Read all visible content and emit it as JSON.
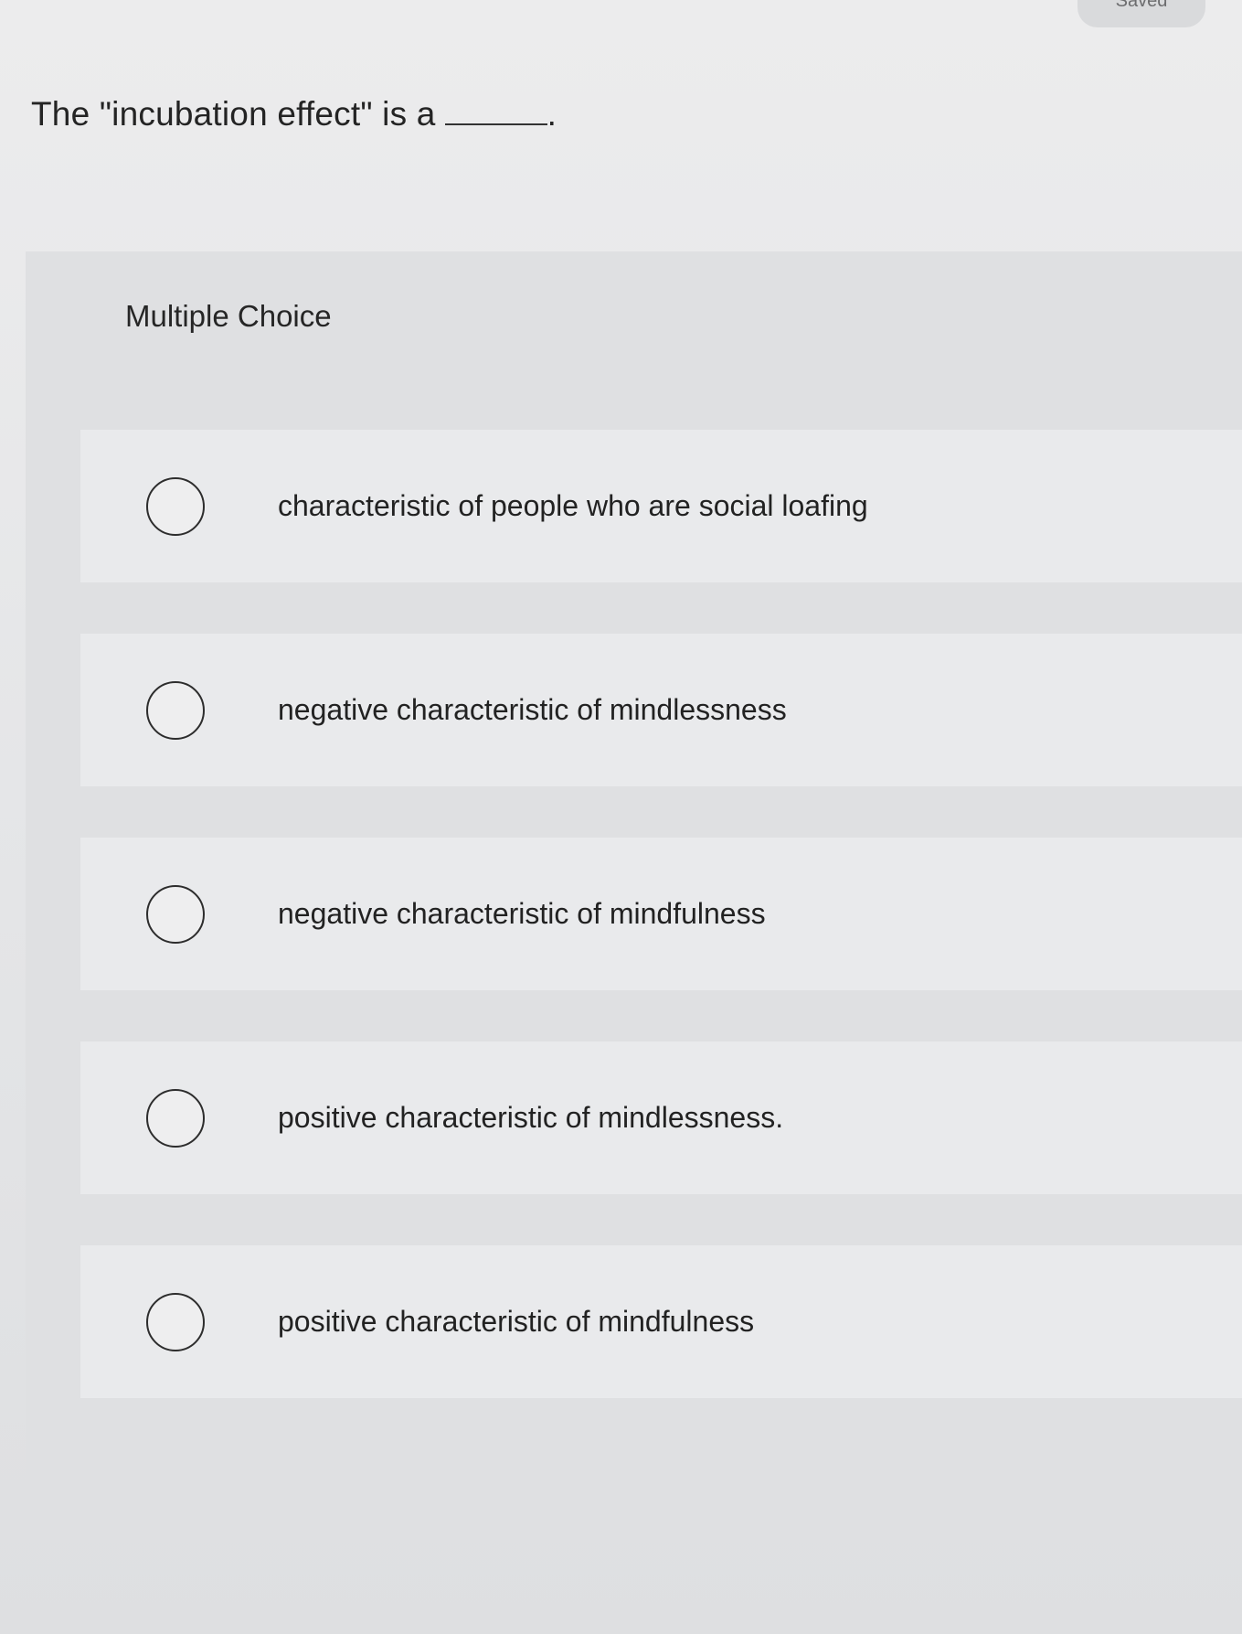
{
  "header": {
    "status_label": "Saved"
  },
  "question": {
    "text": "The \"incubation effect\" is a",
    "end_punctuation": "."
  },
  "multiple_choice": {
    "label": "Multiple Choice",
    "options": [
      {
        "label": "characteristic of people who are social loafing",
        "selected": false
      },
      {
        "label": "negative characteristic of mindlessness",
        "selected": false
      },
      {
        "label": "negative characteristic of mindfulness",
        "selected": false
      },
      {
        "label": "positive characteristic of mindlessness.",
        "selected": false
      },
      {
        "label": "positive characteristic of mindfulness",
        "selected": false
      }
    ]
  }
}
